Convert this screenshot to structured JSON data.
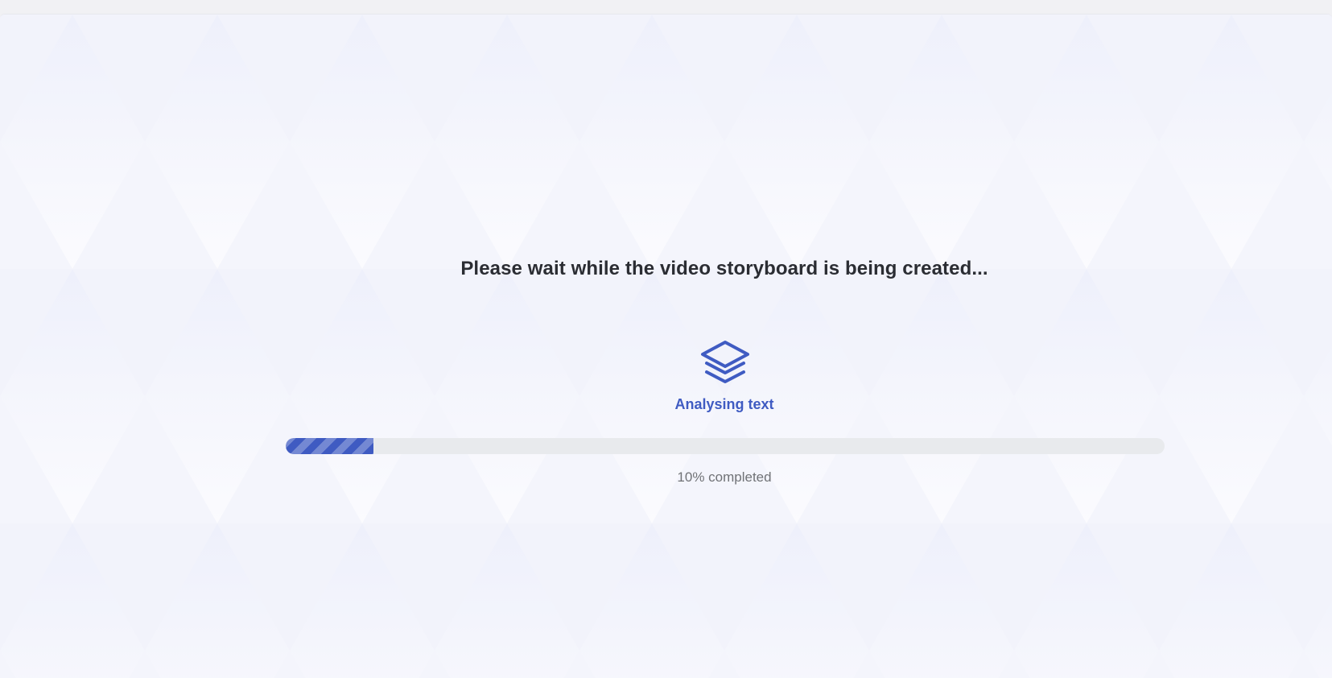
{
  "loading": {
    "title": "Please wait while the video storyboard is being created...",
    "stage_icon": "layers-icon",
    "stage_label": "Analysing text",
    "progress_fraction": 0.1,
    "progress_text": "10% completed"
  },
  "colors": {
    "accent": "#3f5bc2",
    "title_text": "#2b2d33",
    "muted_text": "#707276",
    "track": "#e8eaed",
    "background": "#f6f7fc"
  }
}
